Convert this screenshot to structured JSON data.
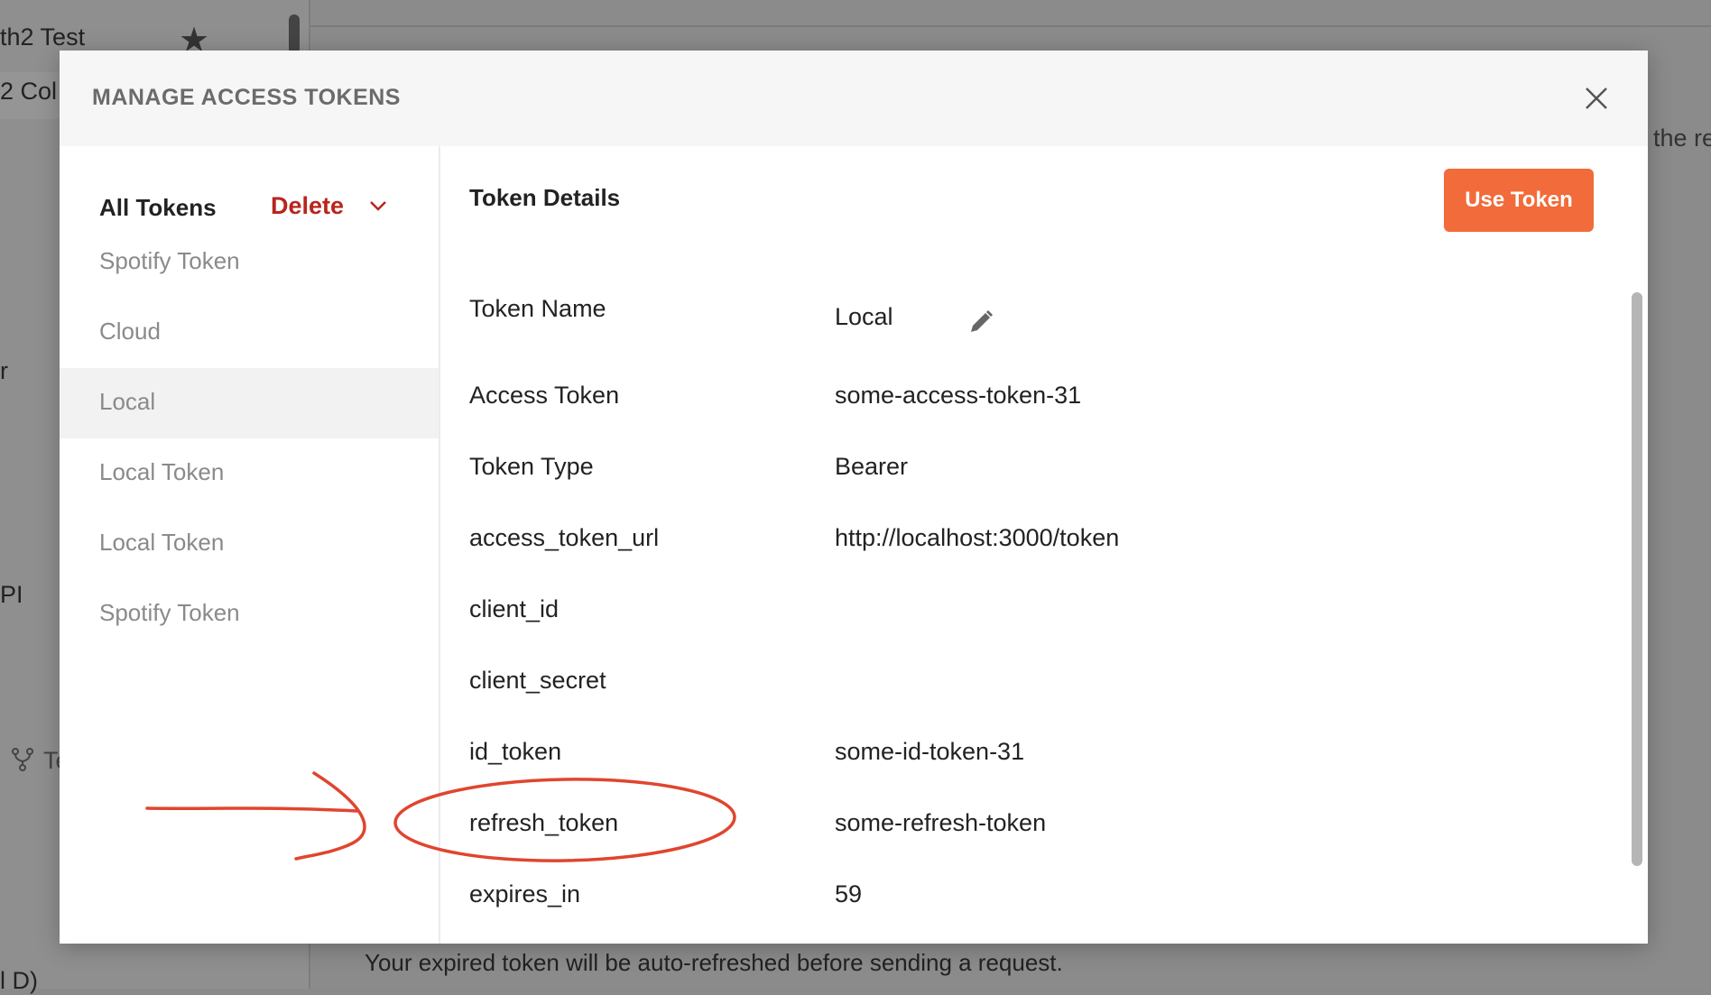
{
  "background": {
    "sidebar_texts": [
      "th2 Test",
      "2 Col",
      "r",
      "PI",
      "Te",
      "l D)"
    ],
    "main_text_right": "the re",
    "footer_note": "Your expired token will be auto-refreshed before sending a request."
  },
  "modal": {
    "title": "MANAGE ACCESS TOKENS",
    "left": {
      "all_tokens_label": "All Tokens",
      "delete_label": "Delete",
      "tokens": [
        "Spotify Token",
        "Cloud",
        "Local",
        "Local Token",
        "Local Token",
        "Spotify Token"
      ],
      "selected_index": 2
    },
    "right": {
      "title": "Token Details",
      "use_token_label": "Use Token",
      "rows": [
        {
          "label": "Token Name",
          "value": "Local"
        },
        {
          "label": "Access Token",
          "value": "some-access-token-31"
        },
        {
          "label": "Token Type",
          "value": "Bearer"
        },
        {
          "label": "access_token_url",
          "value": "http://localhost:3000/token"
        },
        {
          "label": "client_id",
          "value": ""
        },
        {
          "label": "client_secret",
          "value": ""
        },
        {
          "label": "id_token",
          "value": "some-id-token-31"
        },
        {
          "label": "refresh_token",
          "value": "some-refresh-token"
        },
        {
          "label": "expires_in",
          "value": "59"
        }
      ]
    }
  },
  "colors": {
    "accent_button": "#f26b3a",
    "delete_red": "#b8261c",
    "annotation_red": "#e0452e"
  },
  "icons": {
    "close": "close-icon",
    "chevron": "chevron-down-icon",
    "edit": "pencil-icon",
    "star": "star-icon",
    "fork": "fork-icon"
  }
}
